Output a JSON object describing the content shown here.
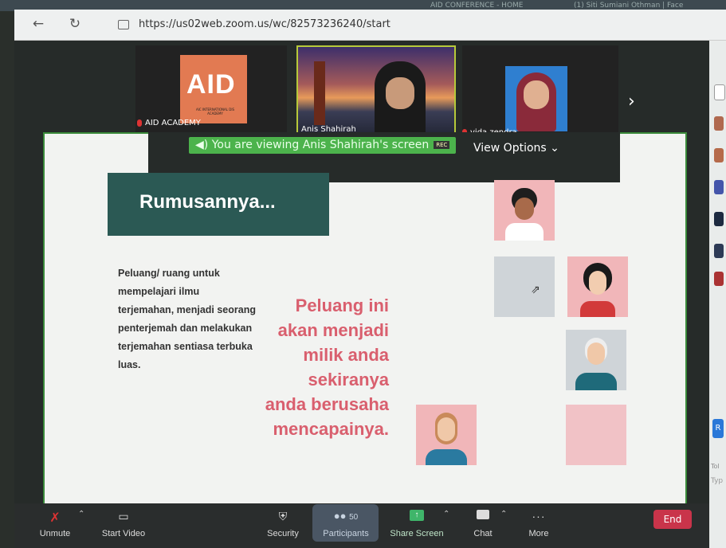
{
  "browser": {
    "tabs": [
      "AID CONFERENCE - HOME",
      "(1) Siti Sumiani Othman | Face"
    ],
    "url": "https://us02web.zoom.us/wc/82573236240/start"
  },
  "participants_strip": [
    {
      "name": "AID ACADEMY",
      "logo_text": "AID",
      "logo_sub": "AIC INTERNATIONAL DIS ACADEMY"
    },
    {
      "name": "Anis Shahirah"
    },
    {
      "name": "vida zendra"
    }
  ],
  "share_banner": {
    "text": "You are viewing Anis Shahirah's screen",
    "rec": "REC",
    "view_options": "View Options"
  },
  "slide": {
    "title": "Rumusannya...",
    "body": "Peluang/ ruang untuk mempelajari ilmu terjemahan, menjadi seorang penterjemah dan melakukan terjemahan sentiasa terbuka luas.",
    "quote_lines": [
      "Peluang ini",
      "akan menjadi",
      "milik anda",
      "sekiranya",
      "anda berusaha",
      "mencapainya."
    ],
    "colors": {
      "title_bg": "#2b5954",
      "quote": "#d95f6e"
    }
  },
  "controls": {
    "unmute": "Unmute",
    "start_video": "Start Video",
    "security": "Security",
    "participants": "Participants",
    "participants_count": "50",
    "share_screen": "Share Screen",
    "chat": "Chat",
    "more": "More",
    "end": "End"
  },
  "right_panel": {
    "partial_label_1": "Tol",
    "partial_label_2": "Typ",
    "partial_button": "R"
  }
}
